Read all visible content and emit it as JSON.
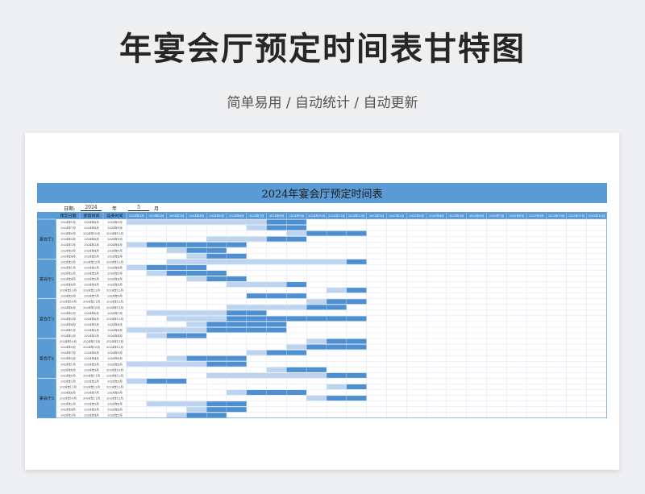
{
  "title": "年宴会厅预定时间表甘特图",
  "subtitle": "简单易用 / 自动统计 / 自动更新",
  "sheet": {
    "banner": "2024年宴会厅预定时间表",
    "date_label": "日期:",
    "year_value": "2024",
    "year_label": "年",
    "month_value": "5",
    "month_label": "月",
    "headers": [
      "预定日期",
      "使用时间",
      "结束时间"
    ],
    "months": [
      "2024年1月",
      "2024年2月",
      "2024年3月",
      "2024年4月",
      "2024年5月",
      "2024年6月",
      "2024年7月",
      "2024年8月",
      "2024年9月",
      "2024年10月",
      "2024年11月",
      "2024年12月",
      "2025年1月",
      "2025年2月",
      "2025年3月",
      "2025年4月",
      "2025年5月",
      "2025年6月",
      "2025年7月",
      "2025年8月",
      "2025年9月",
      "2025年10月",
      "2025年11月",
      "2025年12月"
    ],
    "halls": [
      "宴会厅1",
      "宴会厅2",
      "宴会厅3",
      "宴会厅4",
      "宴会厅5"
    ],
    "rows": [
      [
        "2024年1月",
        "2024年8月",
        "2024年9月"
      ],
      [
        "2024年7月",
        "2024年8月",
        "2024年9月"
      ],
      [
        "2024年9月",
        "2024年10月",
        "2024年12月"
      ],
      [
        "2024年5月",
        "2024年8月",
        "2024年9月"
      ],
      [
        "2024年1月",
        "2024年2月",
        "2024年6月"
      ],
      [
        "2024年3月",
        "2024年4月",
        "2024年5月"
      ],
      [
        "2024年4月",
        "2024年5月",
        "2024年6月"
      ],
      [
        "2024年3月",
        "2024年12月",
        "2024年12月"
      ],
      [
        "2024年1月",
        "2024年2月",
        "2024年4月"
      ],
      [
        "2024年2月",
        "2024年3月",
        "2024年5月"
      ],
      [
        "2024年4月",
        "2024年5月",
        "2024年6月"
      ],
      [
        "2024年6月",
        "2024年9月",
        "2024年9月"
      ],
      [
        "2024年11月",
        "2024年12月",
        "2024年12月"
      ],
      [
        "2024年9月",
        "2024年7月",
        "2024年9月"
      ],
      [
        "2024年10月",
        "2024年11月",
        "2024年12月"
      ],
      [
        "2024年6月",
        "2024年10月",
        "2024年11月"
      ],
      [
        "2024年2月",
        "2024年6月",
        "2024年7月"
      ],
      [
        "2024年3月",
        "2024年6月",
        "2024年12月"
      ],
      [
        "2024年4月",
        "2024年5月",
        "2024年8月"
      ],
      [
        "2024年1月",
        "2024年5月",
        "2024年8月"
      ],
      [
        "2024年2月",
        "2024年3月",
        "2024年4月"
      ],
      [
        "2024年10月",
        "2024年11月",
        "2024年12月"
      ],
      [
        "2024年9月",
        "2024年10月",
        "2024年12月"
      ],
      [
        "2024年7月",
        "2024年8月",
        "2024年9月"
      ],
      [
        "2024年3月",
        "2024年4月",
        "2024年6月"
      ],
      [
        "2024年1月",
        "2024年5月",
        "2024年6月"
      ],
      [
        "2024年8月",
        "2024年9月",
        "2024年10月"
      ],
      [
        "2024年5月",
        "2024年11月",
        "2024年12月"
      ],
      [
        "2024年1月",
        "2024年2月",
        "2024年3月"
      ],
      [
        "2024年11月",
        "2024年12月",
        "2024年12月"
      ],
      [
        "2024年6月",
        "2024年7月",
        "2024年9月"
      ],
      [
        "2024年10月",
        "2024年11月",
        "2024年12月"
      ],
      [
        "2024年2月",
        "2024年5月",
        "2024年6月"
      ],
      [
        "2024年4月",
        "2024年5月",
        "2024年6月"
      ],
      [
        "2024年3月",
        "2024年4月",
        "2024年5月"
      ]
    ],
    "colors": {
      "banner": "#5b9bd5",
      "bar": "#4e8fd1",
      "bar_light": "#bcd4ef",
      "grid_line": "#cfdcec",
      "header_bg": "#5b9bd5"
    }
  }
}
